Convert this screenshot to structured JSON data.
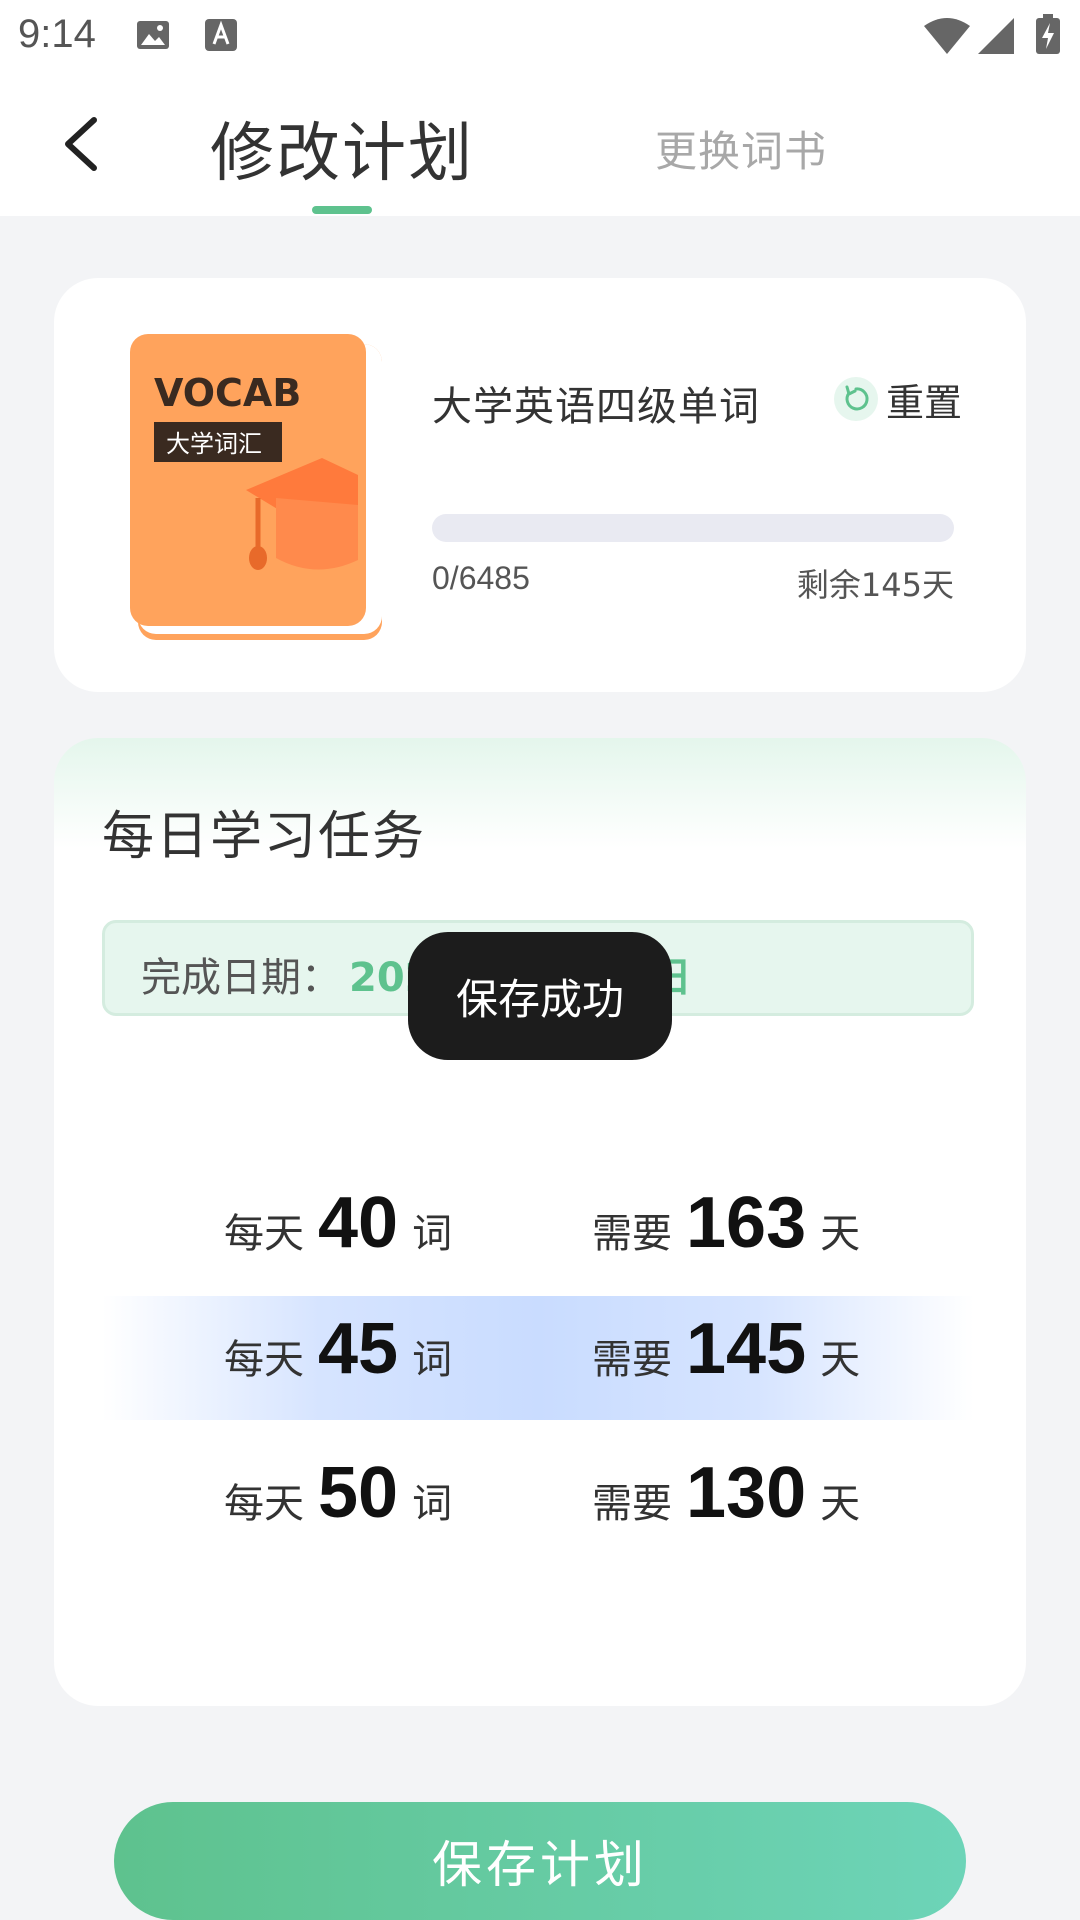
{
  "status_bar": {
    "time": "9:14"
  },
  "header": {
    "active_tab": "修改计划",
    "inactive_tab": "更换词书"
  },
  "book": {
    "cover_title": "VOCAB",
    "cover_subtitle": "大学词汇",
    "title": "大学英语四级单词",
    "reset_label": "重置",
    "progress_text": "0/6485",
    "progress_fraction": 0,
    "remaining": "剩余145天"
  },
  "task": {
    "title": "每日学习任务",
    "date_label": "完成日期：",
    "date_value": "2026年06月14日",
    "plans": [
      {
        "prefix": "每天",
        "words": "40",
        "word_unit": "词",
        "need": "需要",
        "days": "163",
        "day_unit": "天",
        "selected": false
      },
      {
        "prefix": "每天",
        "words": "45",
        "word_unit": "词",
        "need": "需要",
        "days": "145",
        "day_unit": "天",
        "selected": true
      },
      {
        "prefix": "每天",
        "words": "50",
        "word_unit": "词",
        "need": "需要",
        "days": "130",
        "day_unit": "天",
        "selected": false
      }
    ]
  },
  "toast": {
    "message": "保存成功"
  },
  "save_button": {
    "label": "保存计划"
  },
  "colors": {
    "accent": "#5ec28e",
    "book_orange": "#ffa35c",
    "selected_row": "#c9dcff"
  }
}
